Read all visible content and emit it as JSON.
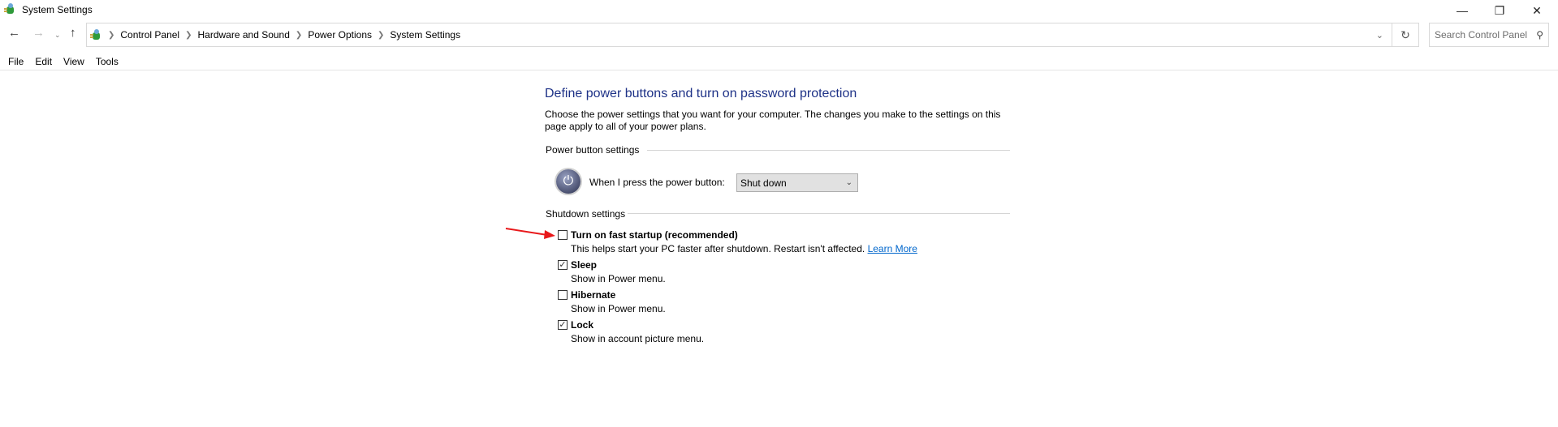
{
  "window": {
    "title": "System Settings",
    "icon": "control-panel-icon",
    "controls": [
      "minimize-icon",
      "restore-icon",
      "close-icon"
    ]
  },
  "nav": {
    "back": "back-arrow-icon",
    "forward": "forward-arrow-icon",
    "recent": "chevron-down-icon",
    "up": "up-arrow-icon"
  },
  "breadcrumb": [
    "Control Panel",
    "Hardware and Sound",
    "Power Options",
    "System Settings"
  ],
  "search": {
    "placeholder": "Search Control Panel"
  },
  "menu": [
    "File",
    "Edit",
    "View",
    "Tools"
  ],
  "main": {
    "heading": "Define power buttons and turn on password protection",
    "description": "Choose the power settings that you want for your computer. The changes you make to the settings on this page apply to all of your power plans.",
    "power_group": "Power button settings",
    "power_label": "When I press the power button:",
    "power_value": "Shut down",
    "shutdown_group": "Shutdown settings",
    "options": [
      {
        "label": "Turn on fast startup (recommended)",
        "desc": "This helps start your PC faster after shutdown. Restart isn't affected.",
        "link": "Learn More",
        "checked": false
      },
      {
        "label": "Sleep",
        "desc": "Show in Power menu.",
        "checked": true
      },
      {
        "label": "Hibernate",
        "desc": "Show in Power menu.",
        "checked": false
      },
      {
        "label": "Lock",
        "desc": "Show in account picture menu.",
        "checked": true
      }
    ]
  },
  "annotation": {
    "arrow_color": "#e8191b"
  },
  "colors": {
    "heading": "#1e3287",
    "link": "#0066cc"
  }
}
